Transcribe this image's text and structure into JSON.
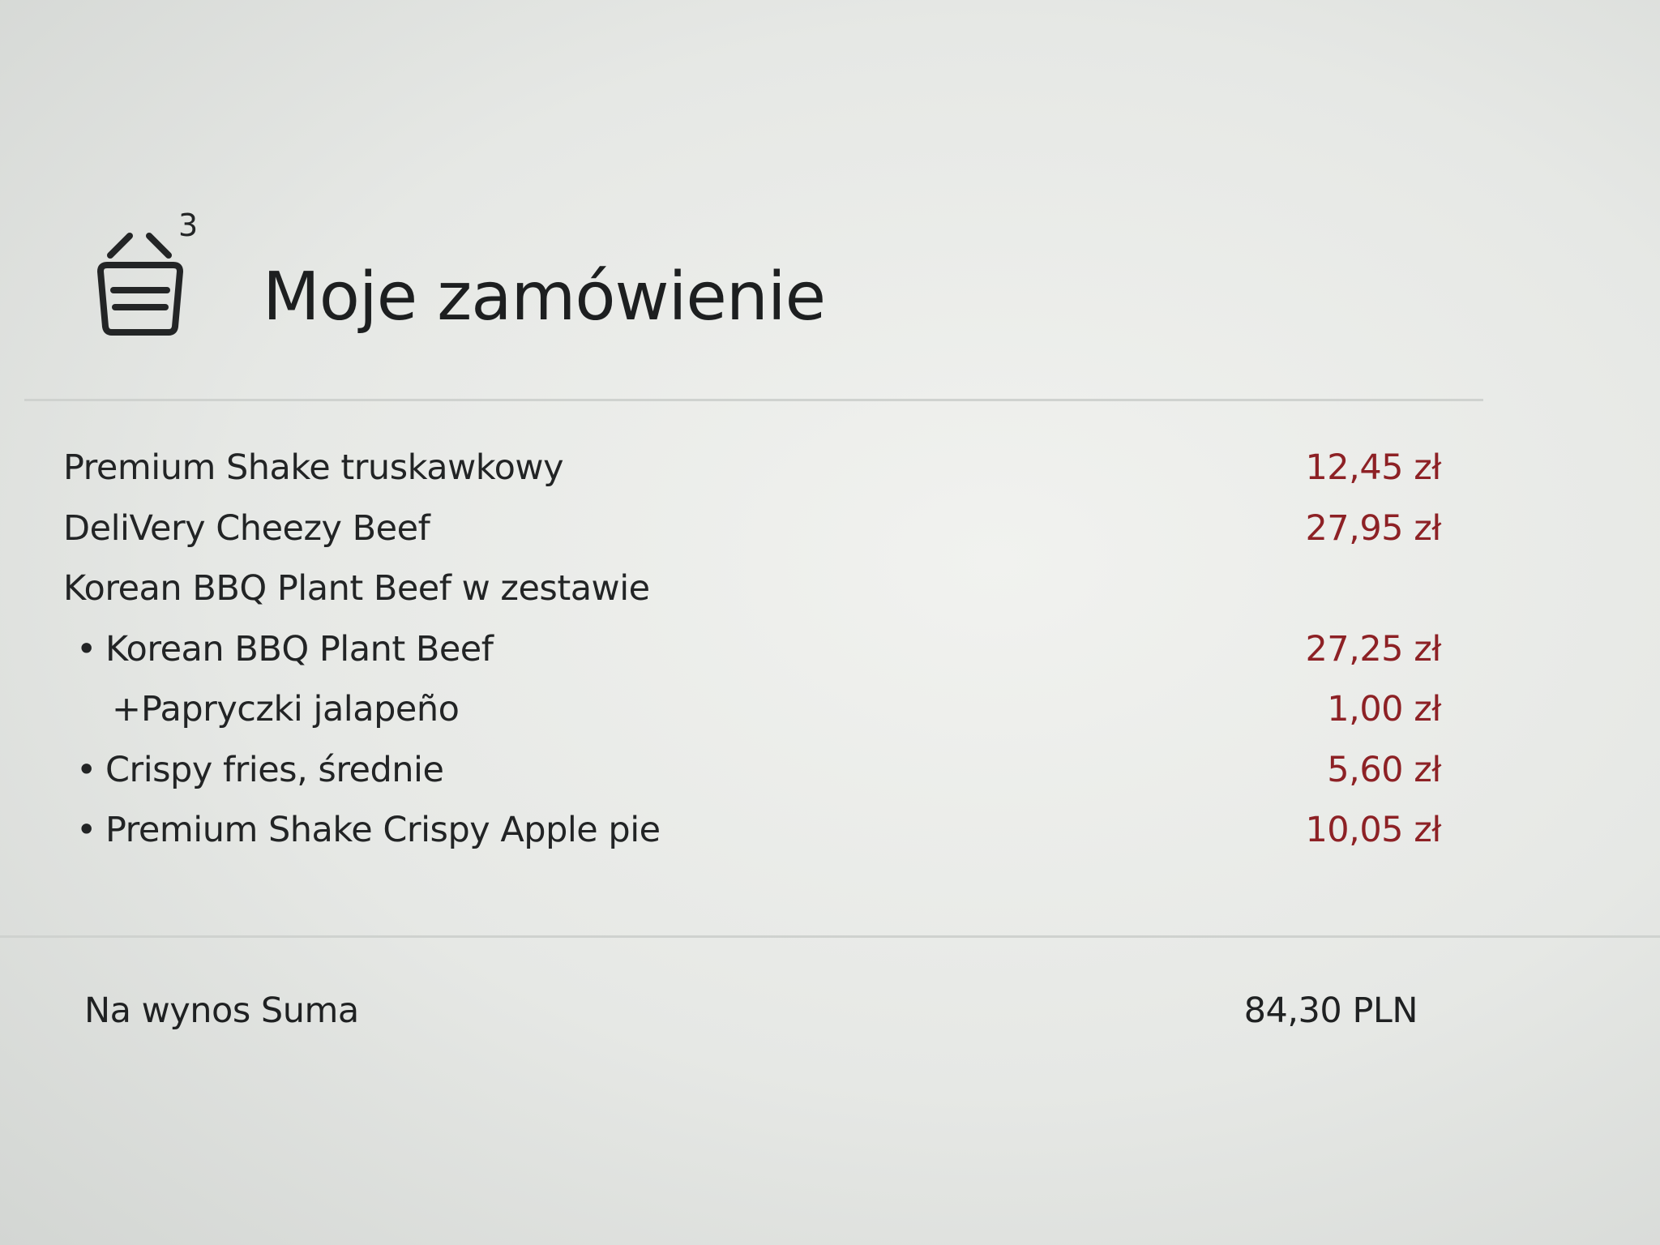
{
  "header": {
    "title": "Moje zamówienie",
    "basket_count": "3",
    "basket_icon": "basket-icon"
  },
  "items": [
    {
      "name": "Premium Shake truskawkowy",
      "price": "12,45 zł"
    },
    {
      "name": "DeliVery Cheezy Beef",
      "price": "27,95 zł"
    },
    {
      "name": "Korean BBQ Plant Beef w zestawie",
      "price": ""
    },
    {
      "name": "Korean BBQ Plant Beef",
      "price": "27,25 zł"
    },
    {
      "name": "Papryczki jalapeño",
      "price": "1,00 zł"
    },
    {
      "name": "Crispy fries, średnie",
      "price": "5,60 zł"
    },
    {
      "name": "Premium Shake Crispy Apple pie",
      "price": "10,05 zł"
    }
  ],
  "markers": {
    "bullet": "•",
    "plus": "+"
  },
  "summary": {
    "label": "Na wynos Suma",
    "total": "84,30 PLN"
  },
  "colors": {
    "price": "#8d2125",
    "text": "#1f2122",
    "background": "#e9ebe8"
  }
}
